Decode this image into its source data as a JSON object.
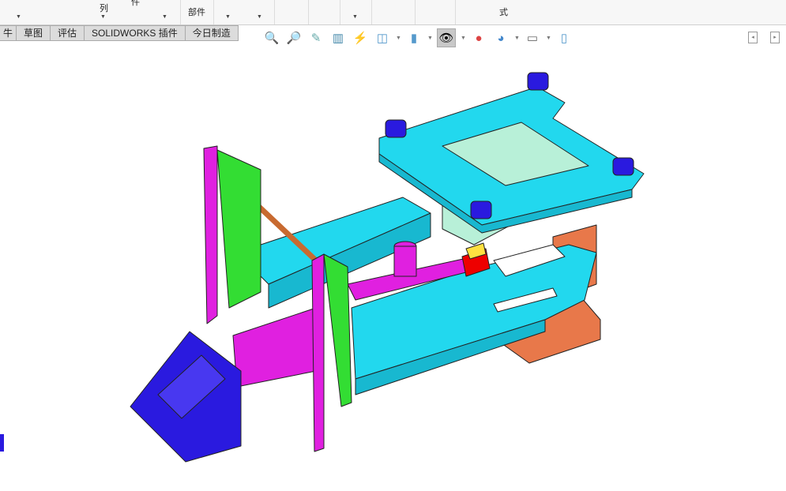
{
  "ribbon": {
    "labels": [
      "列",
      "件",
      "部件",
      "式"
    ]
  },
  "tabs": [
    {
      "label": "牛"
    },
    {
      "label": "草图"
    },
    {
      "label": "评估"
    },
    {
      "label": "SOLIDWORKS 插件"
    },
    {
      "label": "今日制造"
    }
  ],
  "heads_up": [
    "zoom-to-fit-icon",
    "zoom-to-area-icon",
    "previous-view-icon",
    "section-view-icon",
    "dynamic-annotation-icon",
    "view-orientation-icon",
    "display-style-icon",
    "hide-show-items-icon",
    "edit-appearance-icon",
    "apply-scene-icon",
    "view-settings-icon",
    "rotate-icon"
  ],
  "colors": {
    "cyan": "#22d8ee",
    "magenta": "#e020e0",
    "green": "#33dd33",
    "blue": "#2a1adf",
    "orange": "#e8784a",
    "mint": "#b8f0d8"
  }
}
